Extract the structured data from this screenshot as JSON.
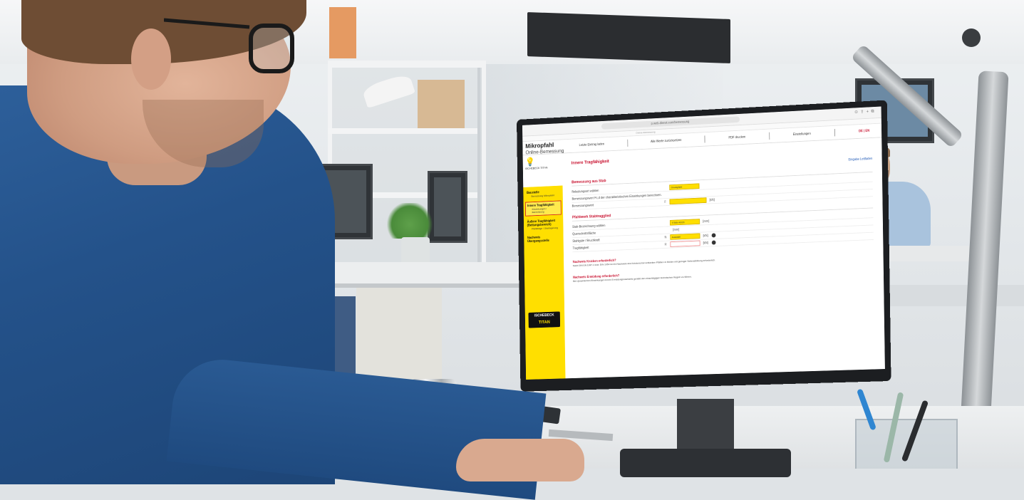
{
  "browser": {
    "url": "p.web-dienst.com/bemessung",
    "tab_text": "Online-Bemessung"
  },
  "app": {
    "logo_line1": "Mikropfahl",
    "logo_line2": "Online-Bemessung",
    "top_nav": [
      "Letzte Eintrag laden",
      "Alle Werte zurücksetzen",
      "PDF drucken",
      "Einstellungen",
      "DE | EN"
    ]
  },
  "sidebar": {
    "product": "ISCHEBECK TITAN",
    "items": [
      {
        "title": "Baustelle",
        "sub": "Bemessung Mikropfahl"
      },
      {
        "title": "Innere Tragfähigkeit",
        "sub": "Einwirkungen / Berechnung"
      },
      {
        "title": "Äußere Tragfähigkeit (Bettungsbereich)",
        "sub": "Pfahllänge / Überlagerung"
      },
      {
        "title": "Nachweis Übergangsstelle",
        "sub": ""
      }
    ],
    "brand_line1": "ISCHEBECK",
    "brand_line2": "TITAN"
  },
  "content": {
    "heading": "Innere Tragfähigkeit",
    "guide_link": "Eingabe Leitfaden",
    "section1": "Bemessung aus Stab",
    "rows1": [
      {
        "label": "Belastungsart wählen",
        "mid": "",
        "value": "Druckpfahl",
        "unit": ""
      },
      {
        "label": "Bemessungswert Fc,d der charakteristischen Einwirkungen berechnen.",
        "mid": "",
        "value": "",
        "unit": ""
      },
      {
        "label": "Bemessungswert",
        "mid": "F",
        "value": "",
        "unit": "[kN]"
      }
    ],
    "section2": "Pfahlwerk Stabtragglied",
    "rows2": [
      {
        "label": "Stab-Bezeichnung wählen",
        "mid": "",
        "value": "TITAN 40/20",
        "unit": "[mm]"
      },
      {
        "label": "Querschnittsfläche",
        "mid": "",
        "value": "",
        "unit": "[mm]"
      },
      {
        "label": "Stahlgüte / Bruchkraft",
        "mid": "N",
        "value": "Auswahl",
        "unit": "[kN]"
      },
      {
        "label": "Tragfähigkeit",
        "mid": "R",
        "value": "",
        "unit": "[kN]"
      }
    ],
    "notice1_title": "Nachweis Knicken erforderlich?",
    "notice1_text": "Nach DIN EN 1997-1 bzw. DIN 1054 ist ein Nachweis des Knickens bei schlanken Pfählen in Böden mit geringer Seitenstützung erforderlich.",
    "notice2_title": "Nachweis Ermüdung erforderlich?",
    "notice2_text": "Bei dynamischen Einwirkungen ist ein Ermüdungsnachweis gemäß den einschlägigen technischen Regeln zu führen."
  }
}
